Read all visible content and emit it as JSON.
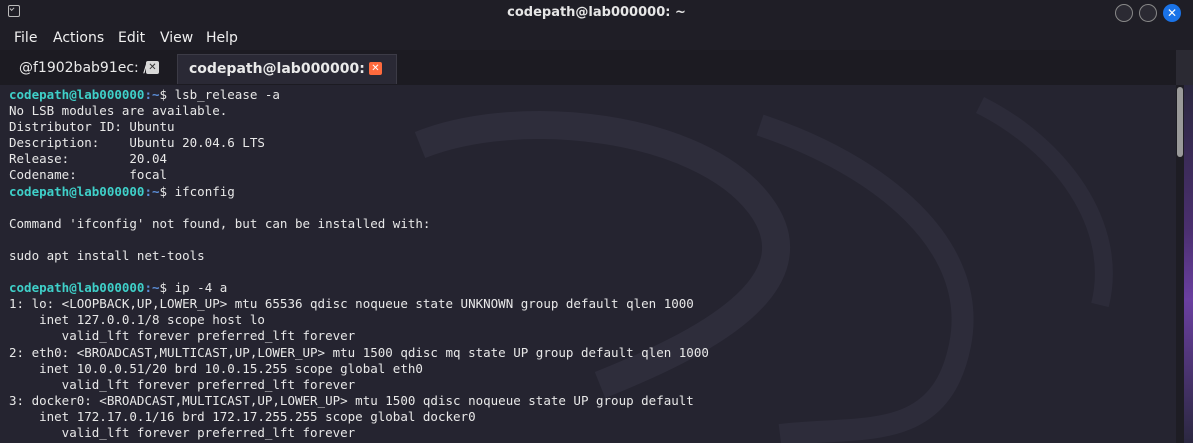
{
  "window": {
    "title": "codepath@lab000000: ~",
    "close_glyph": "✕"
  },
  "menu": [
    "File",
    "Actions",
    "Edit",
    "View",
    "Help"
  ],
  "tabs": [
    {
      "label": "@f1902bab91ec: /",
      "active": false,
      "close_glyph": "✕"
    },
    {
      "label": "codepath@lab000000: ~",
      "active": true,
      "close_glyph": "✕"
    }
  ],
  "terminal": {
    "prompt_user": "codepath@lab000000",
    "prompt_path": ":~",
    "prompt_symbol": "$ ",
    "lines": [
      {
        "type": "prompt",
        "cmd": "lsb_release -a"
      },
      {
        "type": "out",
        "text": "No LSB modules are available."
      },
      {
        "type": "out",
        "text": "Distributor ID: Ubuntu"
      },
      {
        "type": "out",
        "text": "Description:    Ubuntu 20.04.6 LTS"
      },
      {
        "type": "out",
        "text": "Release:        20.04"
      },
      {
        "type": "out",
        "text": "Codename:       focal"
      },
      {
        "type": "prompt",
        "cmd": "ifconfig"
      },
      {
        "type": "out",
        "text": ""
      },
      {
        "type": "out",
        "text": "Command 'ifconfig' not found, but can be installed with:"
      },
      {
        "type": "out",
        "text": ""
      },
      {
        "type": "out",
        "text": "sudo apt install net-tools"
      },
      {
        "type": "out",
        "text": ""
      },
      {
        "type": "prompt",
        "cmd": "ip -4 a"
      },
      {
        "type": "out",
        "text": "1: lo: <LOOPBACK,UP,LOWER_UP> mtu 65536 qdisc noqueue state UNKNOWN group default qlen 1000"
      },
      {
        "type": "out",
        "text": "    inet 127.0.0.1/8 scope host lo"
      },
      {
        "type": "out",
        "text": "       valid_lft forever preferred_lft forever"
      },
      {
        "type": "out",
        "text": "2: eth0: <BROADCAST,MULTICAST,UP,LOWER_UP> mtu 1500 qdisc mq state UP group default qlen 1000"
      },
      {
        "type": "out",
        "text": "    inet 10.0.0.51/20 brd 10.0.15.255 scope global eth0"
      },
      {
        "type": "out",
        "text": "       valid_lft forever preferred_lft forever"
      },
      {
        "type": "out",
        "text": "3: docker0: <BROADCAST,MULTICAST,UP,LOWER_UP> mtu 1500 qdisc noqueue state UP group default"
      },
      {
        "type": "out",
        "text": "    inet 172.17.0.1/16 brd 172.17.255.255 scope global docker0"
      },
      {
        "type": "out",
        "text": "       valid_lft forever preferred_lft forever"
      }
    ]
  },
  "colors": {
    "prompt_user": "#3fd0c9",
    "prompt_path": "#5b8dd6",
    "active_tab_close": "#ff6a3d",
    "window_close": "#1a73e8"
  }
}
